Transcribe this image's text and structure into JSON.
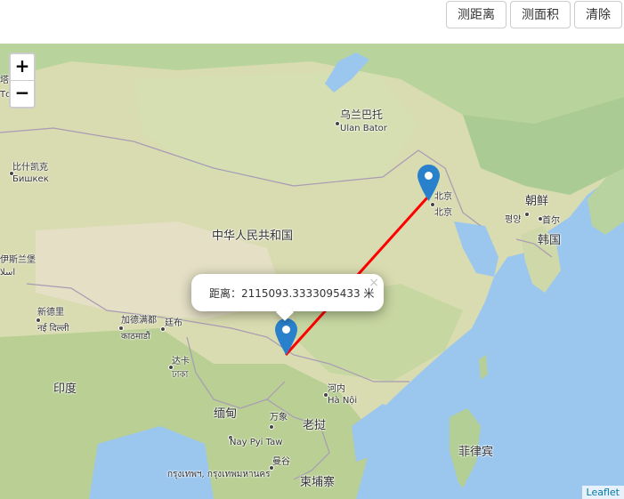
{
  "toolbar": {
    "measure_distance": "测距离",
    "measure_area": "测面积",
    "clear": "清除"
  },
  "zoom": {
    "in": "+",
    "out": "−"
  },
  "popup": {
    "text": "距离：2115093.3333095433 米",
    "close": "×"
  },
  "attribution": "Leaflet",
  "measure_line_color": "#ff0000",
  "marker_color": "#2a81cb",
  "labels": {
    "ulaanbaatar_cn": "乌兰巴托",
    "ulaanbaatar_en": "Ulan Bator",
    "bishkek_cn": "比什凯克",
    "bishkek_ru": "Бишкек",
    "beijing_1": "北京",
    "beijing_2": "北京",
    "china": "中华人民共和国",
    "north_korea": "朝鲜",
    "pyongyang_ko": "평양",
    "seoul": "首尔",
    "south_korea": "韩国",
    "new_delhi_cn": "新德里",
    "new_delhi_hi": "नई दिल्ली",
    "kathmandu_cn": "加德满都",
    "kathmandu_ne": "काठमाडौं",
    "thimphu_cn": "廷布",
    "dhaka_cn": "达卡",
    "dhaka_bn": "ঢাকা",
    "india": "印度",
    "hanoi_cn": "河内",
    "hanoi_vi": "Hà Nội",
    "myanmar": "缅甸",
    "vientiane_cn": "万象",
    "laos": "老挝",
    "naypyitaw": "Nay Pyi Taw",
    "bangkok_cn": "曼谷",
    "bangkok_th": "กรุงเทพฯ, กรุงเทพมหานคร",
    "cambodia": "柬埔寨",
    "philippines": "菲律宾",
    "edge_top": "塔什",
    "edge_top2": "Тош",
    "edge_mid": "伊斯兰堡",
    "edge_mid2": "اسلا"
  }
}
